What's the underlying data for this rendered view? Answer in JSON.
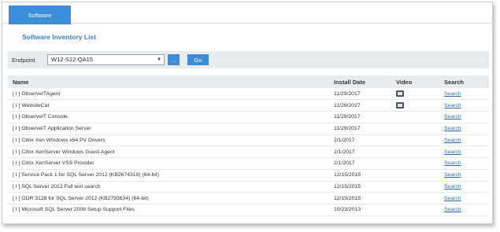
{
  "tabs": [
    {
      "label": "Software"
    }
  ],
  "page": {
    "title": "Software Inventory List"
  },
  "filter": {
    "endpoint_label": "Endpoint",
    "endpoint_value": "W12-S12-QA15",
    "more_label": "...",
    "go_label": "Go"
  },
  "table": {
    "columns": [
      "Name",
      "Install Date",
      "Video",
      "Search"
    ],
    "rows": [
      {
        "name": "[ I ] ObserveITAgent",
        "date": "11/29/2017",
        "video": true,
        "search": "Search"
      },
      {
        "name": "[ I ] WebsiteCat",
        "date": "11/29/2017",
        "video": true,
        "search": "Search"
      },
      {
        "name": "[ I ] ObserveIT Console",
        "date": "11/29/2017",
        "video": false,
        "search": "Search"
      },
      {
        "name": "[ I ] ObserveIT Application Server",
        "date": "11/29/2017",
        "video": false,
        "search": "Search"
      },
      {
        "name": "[ I ] Citrix Xen Windows x64 PV Drivers",
        "date": "2/1/2017",
        "video": false,
        "search": "Search"
      },
      {
        "name": "[ I ] Citrix XenServer Windows Guest Agent",
        "date": "2/1/2017",
        "video": false,
        "search": "Search"
      },
      {
        "name": "[ I ] Citrix XenServer VSS Provider",
        "date": "2/1/2017",
        "video": false,
        "search": "Search"
      },
      {
        "name": "[ I ] Service Pack 1 for SQL Server 2012 (KB2674319) (64-bit)",
        "date": "12/15/2015",
        "video": false,
        "search": "Search"
      },
      {
        "name": "[ I ] SQL Server 2012 Full text search",
        "date": "12/15/2015",
        "video": false,
        "search": "Search"
      },
      {
        "name": "[ I ] GDR 3128 for SQL Server 2012 (KB2793634) (64-bit)",
        "date": "12/15/2015",
        "video": false,
        "search": "Search"
      },
      {
        "name": "[ I ] Microsoft SQL Server 2008 Setup Support Files",
        "date": "10/23/2013",
        "video": false,
        "search": "Search"
      }
    ]
  },
  "colors": {
    "accent": "#3c8ed9",
    "link": "#2a6fb8",
    "header_bg": "#e9ecef"
  }
}
